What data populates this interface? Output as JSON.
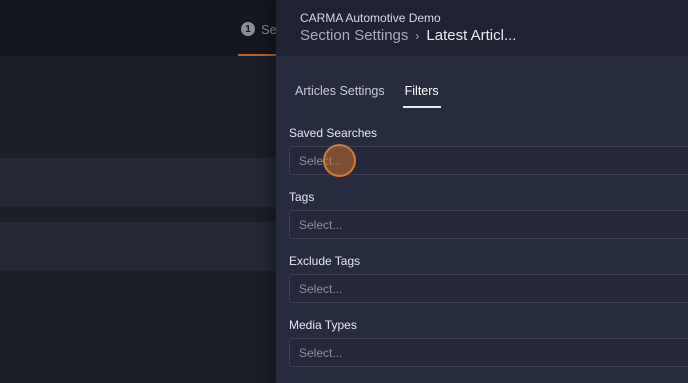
{
  "background": {
    "step_number": "1",
    "step_label": "Se"
  },
  "panel": {
    "app_name": "CARMA Automotive Demo",
    "breadcrumb": {
      "parent": "Section Settings",
      "separator": "›",
      "current": "Latest Articl..."
    },
    "tabs": [
      {
        "label": "Articles Settings",
        "active": false
      },
      {
        "label": "Filters",
        "active": true
      }
    ],
    "fields": [
      {
        "label": "Saved Searches",
        "placeholder": "Select..."
      },
      {
        "label": "Tags",
        "placeholder": "Select..."
      },
      {
        "label": "Exclude Tags",
        "placeholder": "Select..."
      },
      {
        "label": "Media Types",
        "placeholder": "Select..."
      }
    ]
  },
  "colors": {
    "accent": "#b8642a",
    "panel_bg": "#272b3e",
    "header_bg": "#1e2233"
  }
}
